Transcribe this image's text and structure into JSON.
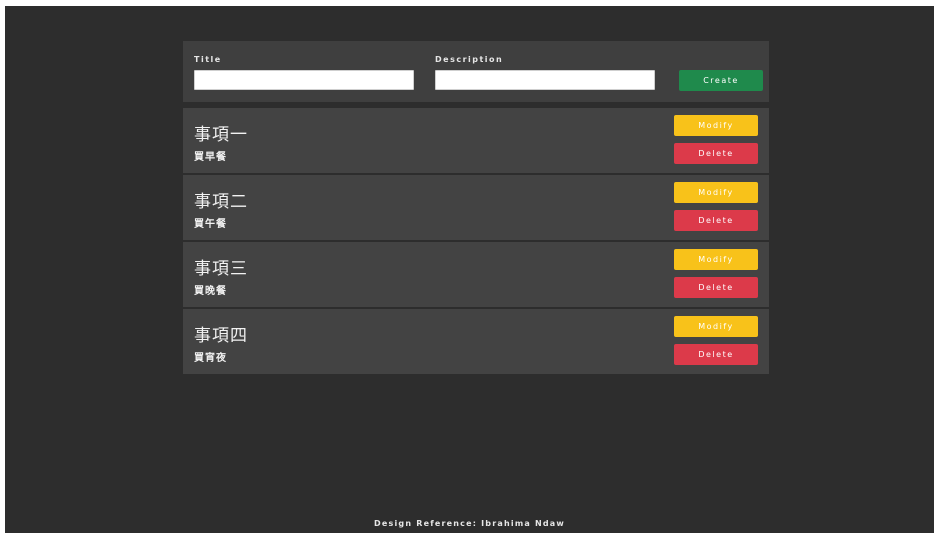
{
  "form": {
    "title_label": "Title",
    "title_value": "",
    "description_label": "Description",
    "description_value": "",
    "create_label": "Create"
  },
  "todos": [
    {
      "title": "事項一",
      "description": "買早餐",
      "modify_label": "Modify",
      "delete_label": "Delete"
    },
    {
      "title": "事項二",
      "description": "買午餐",
      "modify_label": "Modify",
      "delete_label": "Delete"
    },
    {
      "title": "事項三",
      "description": "買晚餐",
      "modify_label": "Modify",
      "delete_label": "Delete"
    },
    {
      "title": "事項四",
      "description": "買宵夜",
      "modify_label": "Modify",
      "delete_label": "Delete"
    }
  ],
  "footer": {
    "text": "Design Reference: Ibrahima Ndaw"
  },
  "colors": {
    "background": "#2d2d2d",
    "panel": "#3f3f3f",
    "create": "#1f8a4c",
    "modify": "#f8c21a",
    "delete": "#dc3a4a"
  }
}
